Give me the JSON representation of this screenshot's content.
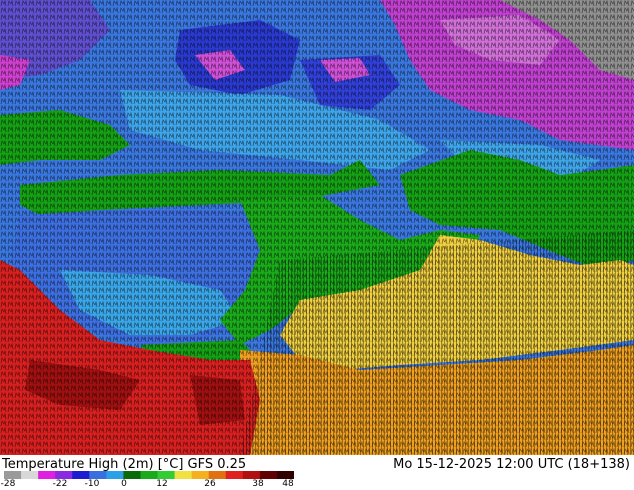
{
  "map": {
    "title": "Temperature High (2m) [°C] GFS 0.25",
    "run": "Mo 15-12-2025 12:00 UTC (18+138)"
  },
  "legend": {
    "ticks": [
      "-28",
      "-22",
      "-10",
      "0",
      "12",
      "26",
      "38",
      "48"
    ],
    "colors": [
      "#9a9a9a",
      "#d8d8d8",
      "#e020e0",
      "#8a2be2",
      "#1c1cd0",
      "#3a6fe0",
      "#2aa0e8",
      "#0a6a0a",
      "#1aaa1a",
      "#32cd32",
      "#f0e040",
      "#f5b020",
      "#e07010",
      "#e02020",
      "#b01010",
      "#600000",
      "#300000"
    ]
  },
  "palette": {
    "north_purple": "#c040d0",
    "gray_top": "#909090",
    "blue_deep": "#3050d8",
    "blue_mid": "#3a78e0",
    "cyan": "#40a0e8",
    "green": "#15a015",
    "green_dark": "#0e7a0e",
    "yellow": "#f0d040",
    "orange": "#f0a020",
    "red": "#d82020",
    "dark_red": "#a01010"
  }
}
